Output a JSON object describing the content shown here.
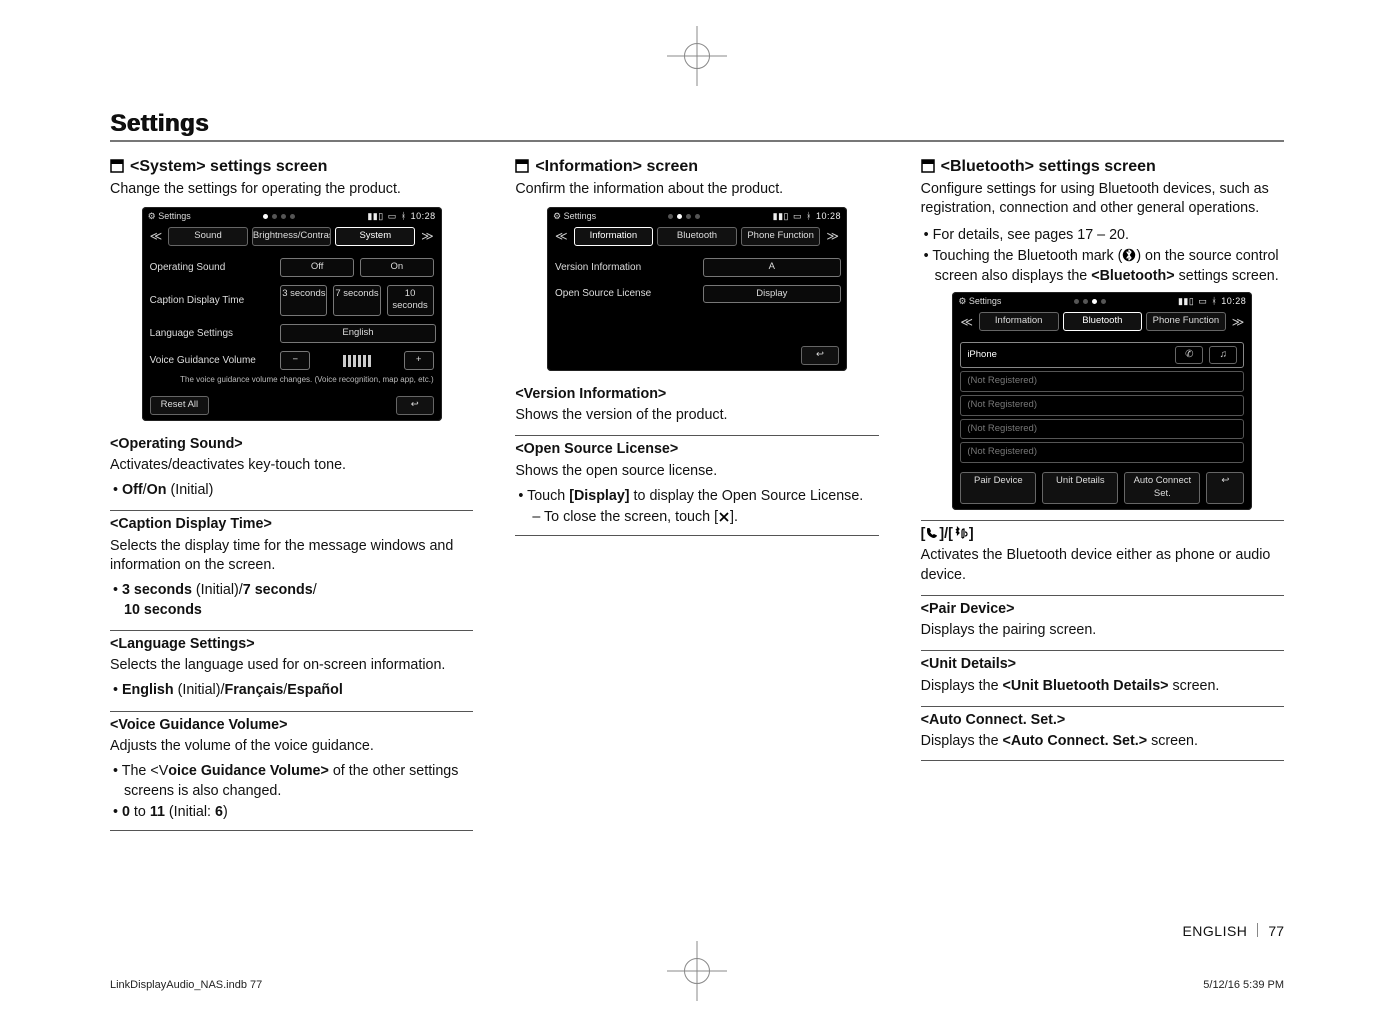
{
  "header": {
    "title": "Settings"
  },
  "footer": {
    "lang": "ENGLISH",
    "page": "77",
    "indb": "LinkDisplayAudio_NAS.indb   77",
    "timestamp": "5/12/16   5:39 PM"
  },
  "col1": {
    "section_title": "<System> settings screen",
    "lead": "Change the settings for operating the product.",
    "sshot": {
      "top_label": "Settings",
      "time": "10:28",
      "tabs": [
        "Sound",
        "Brightness/Contrast",
        "System"
      ],
      "active_tab": 2,
      "rows": {
        "op_sound": {
          "label": "Operating Sound",
          "opts": [
            "Off",
            "On"
          ]
        },
        "caption": {
          "label": "Caption Display Time",
          "opts": [
            "3 seconds",
            "7 seconds",
            "10 seconds"
          ]
        },
        "lang": {
          "label": "Language Settings",
          "val": "English"
        },
        "voice": {
          "label": "Voice Guidance Volume"
        }
      },
      "note": "The voice guidance volume changes. (Voice recognition, map app, etc.)",
      "reset": "Reset All"
    },
    "s1": {
      "title": "<Operating Sound>",
      "body": "Activates/deactivates key-touch tone.",
      "opt_off": "Off",
      "opt_on": "On",
      "initial": " (Initial)"
    },
    "s2": {
      "title": "<Caption Display Time>",
      "body": "Selects the display time for the message windows and information on the screen.",
      "o1": "3 seconds",
      "ini": " (Initial)/",
      "o2": "7 seconds",
      "slash": "/",
      "o3": "10 seconds"
    },
    "s3": {
      "title": "<Language Settings>",
      "body": "Selects the language used for on-screen information.",
      "o1": "English",
      "ini": " (Initial)/",
      "o2": "Français",
      "slash": "/",
      "o3": "Español"
    },
    "s4": {
      "title": "<Voice Guidance Volume>",
      "body": "Adjusts the volume of the voice guidance.",
      "b1a": "The <V",
      "b1b": "oice Guidance Volume>",
      "b1c": " of the other settings screens is also changed.",
      "b2a": "0",
      "b2b": " to ",
      "b2c": "11",
      "b2d": " (Initial: ",
      "b2e": "6",
      "b2f": ")"
    }
  },
  "col2": {
    "section_title": "<Information> screen",
    "lead": "Confirm the information about the product.",
    "sshot": {
      "top_label": "Settings",
      "time": "10:28",
      "tabs": [
        "Information",
        "Bluetooth",
        "Phone Function"
      ],
      "active_tab": 0,
      "rows": {
        "ver": {
          "label": "Version Information",
          "val": "A"
        },
        "osl": {
          "label": "Open Source License",
          "val": "Display"
        }
      }
    },
    "s1": {
      "title": "<Version Information>",
      "body": "Shows the version of the product."
    },
    "s2": {
      "title": "<Open Source License>",
      "body": "Shows the open source license.",
      "b1a": "Touch ",
      "b1b": "[Display]",
      "b1c": " to display the Open Source License.",
      "b2a": "To close the screen, touch [",
      "b2b": "]."
    }
  },
  "col3": {
    "section_title": "<Bluetooth> settings screen",
    "lead": "Configure settings for using Bluetooth devices, such as registration, connection and other general operations.",
    "b1": "For details, see pages 17 – 20.",
    "b2a": "Touching the Bluetooth mark (",
    "b2b": ") on the source control screen also displays the ",
    "b2c": "<Bluetooth>",
    "b2d": " settings screen.",
    "sshot": {
      "top_label": "Settings",
      "time": "10:28",
      "tabs": [
        "Information",
        "Bluetooth",
        "Phone Function"
      ],
      "active_tab": 1,
      "list": [
        "iPhone",
        "(Not Registered)",
        "(Not Registered)",
        "(Not Registered)",
        "(Not Registered)"
      ],
      "footer": [
        "Pair Device",
        "Unit Details",
        "Auto Connect Set."
      ]
    },
    "iconline_pre": "[",
    "iconline_mid": "]/[",
    "iconline_post": "]",
    "iconline_body": "Activates the Bluetooth device either as phone or audio device.",
    "s1": {
      "title": "<Pair Device>",
      "body": "Displays the pairing screen."
    },
    "s2": {
      "title": "<Unit Details>",
      "pre": "Displays the ",
      "b": "<Unit Bluetooth Details>",
      "post": " screen."
    },
    "s3": {
      "title": "<Auto Connect. Set.>",
      "pre": "Displays the ",
      "b": "<Auto Connect. Set.>",
      "post": " screen."
    }
  }
}
